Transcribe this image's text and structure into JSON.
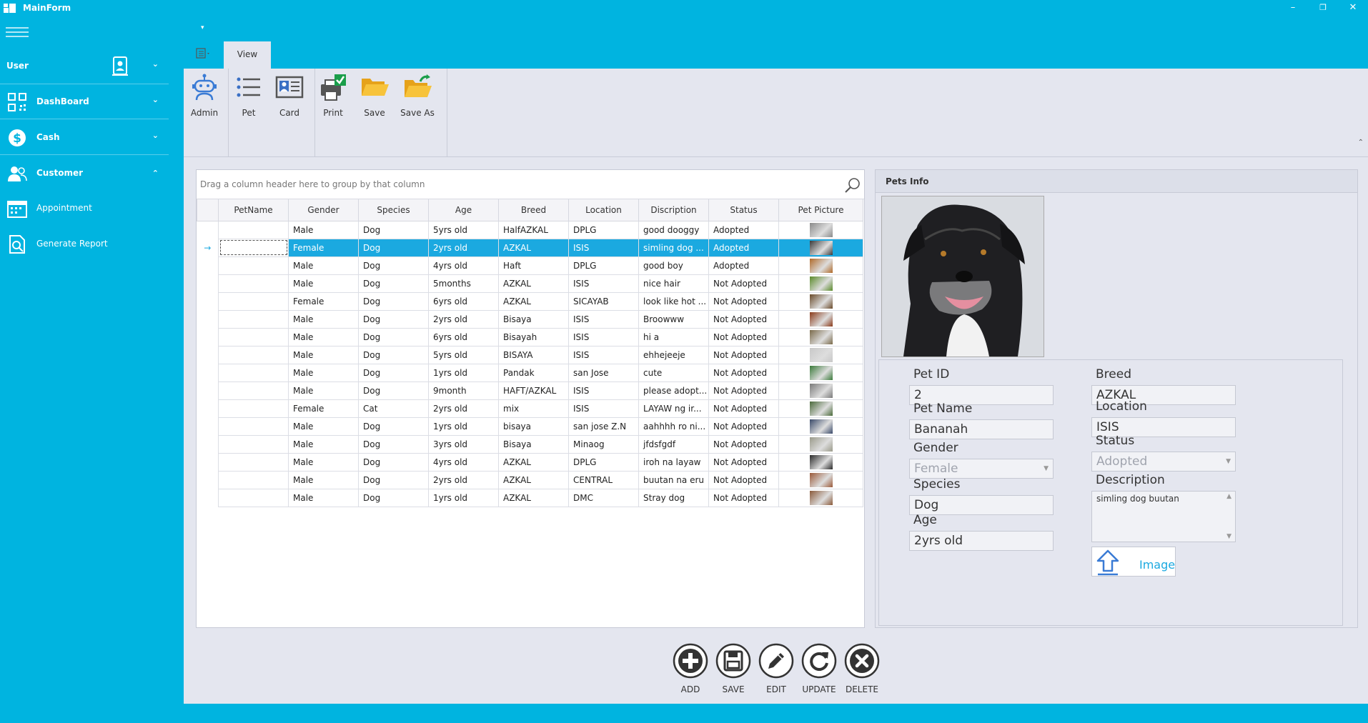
{
  "window": {
    "title": "MainForm",
    "controls": [
      "minimize",
      "restore",
      "close"
    ]
  },
  "sidebar": {
    "user_label": "User",
    "items": [
      {
        "label": "DashBoard",
        "icon": "qr-code-icon",
        "expanded": false
      },
      {
        "label": "Cash",
        "icon": "dollar-icon",
        "expanded": false
      },
      {
        "label": "Customer",
        "icon": "users-icon",
        "expanded": true
      }
    ],
    "sub_items": [
      {
        "label": "Appointment",
        "icon": "calendar-icon"
      },
      {
        "label": "Generate Report",
        "icon": "report-search-icon"
      }
    ]
  },
  "ribbon": {
    "tab": "View",
    "buttons": [
      {
        "label": "Admin",
        "icon": "robot-icon"
      },
      {
        "label": "Pet",
        "icon": "list-icon"
      },
      {
        "label": "Card",
        "icon": "id-card-icon"
      },
      {
        "label": "Print",
        "icon": "printer-icon"
      },
      {
        "label": "Save",
        "icon": "folder-icon"
      },
      {
        "label": "Save As",
        "icon": "folder-refresh-icon"
      }
    ]
  },
  "grid": {
    "group_panel_text": "Drag a column header here to group by that column",
    "columns": [
      "PetName",
      "Gender",
      "Species",
      "Age",
      "Breed",
      "Location",
      "Discription",
      "Status",
      "Pet Picture"
    ],
    "selected_row_index": 1,
    "rows": [
      [
        "",
        "Male",
        "Dog",
        "5yrs old",
        "HalfAZKAL",
        "DPLG",
        "good dooggy",
        "Adopted"
      ],
      [
        "",
        "Female",
        "Dog",
        "2yrs old",
        "AZKAL",
        "ISIS",
        "simling dog ...",
        "Adopted"
      ],
      [
        "",
        "Male",
        "Dog",
        "4yrs old",
        "Haft",
        "DPLG",
        "good boy",
        "Adopted"
      ],
      [
        "",
        "Male",
        "Dog",
        "5months",
        "AZKAL",
        "ISIS",
        "nice hair",
        "Not Adopted"
      ],
      [
        "",
        "Female",
        "Dog",
        "6yrs old",
        "AZKAL",
        "SICAYAB",
        "look like hot ...",
        "Not Adopted"
      ],
      [
        "",
        "Male",
        "Dog",
        "2yrs old",
        "Bisaya",
        "ISIS",
        "Broowww",
        "Not Adopted"
      ],
      [
        "",
        "Male",
        "Dog",
        "6yrs old",
        "Bisayah",
        "ISIS",
        "hi a",
        "Not Adopted"
      ],
      [
        "",
        "Male",
        "Dog",
        "5yrs old",
        "BISAYA",
        "ISIS",
        "ehhejeeje",
        "Not Adopted"
      ],
      [
        "",
        "Male",
        "Dog",
        "1yrs old",
        "Pandak",
        "san Jose",
        "cute",
        "Not Adopted"
      ],
      [
        "",
        "Male",
        "Dog",
        "9month",
        "HAFT/AZKAL",
        "ISIS",
        "please adopt...",
        "Not Adopted"
      ],
      [
        "",
        "Female",
        "Cat",
        "2yrs old",
        "mix",
        "ISIS",
        "LAYAW ng ir...",
        "Not Adopted"
      ],
      [
        "",
        "Male",
        "Dog",
        "1yrs old",
        "bisaya",
        "san jose  Z.N",
        "aahhhh ro ni...",
        "Not Adopted"
      ],
      [
        "",
        "Male",
        "Dog",
        "3yrs old",
        "Bisaya",
        "Minaog",
        "jfdsfgdf",
        "Not Adopted"
      ],
      [
        "",
        "Male",
        "Dog",
        "4yrs old",
        "AZKAL",
        "DPLG",
        "iroh na layaw",
        "Not Adopted"
      ],
      [
        "",
        "Male",
        "Dog",
        "2yrs old",
        "AZKAL",
        "CENTRAL",
        "buutan na eru",
        "Not Adopted"
      ],
      [
        "",
        "Male",
        "Dog",
        "1yrs old",
        "AZKAL",
        "DMC",
        "Stray dog",
        "Not Adopted"
      ]
    ],
    "thumb_colors": [
      "#8a8a8a",
      "#3a3a3a",
      "#b06a2a",
      "#5a8a2a",
      "#6a4a2a",
      "#8a3a1a",
      "#7a6a4a",
      "#c8c8c8",
      "#3a7a3a",
      "#7a7a7a",
      "#4a6a3a",
      "#3a4a6a",
      "#9a9a8a",
      "#2a2a2a",
      "#9a5a3a",
      "#8a5a3a"
    ]
  },
  "pets_info": {
    "title": "Pets Info",
    "labels": {
      "pet_id": "Pet ID",
      "pet_name": "Pet Name",
      "gender": "Gender",
      "species": "Species",
      "age": "Age",
      "breed": "Breed",
      "location": "Location",
      "status": "Status",
      "description": "Description"
    },
    "values": {
      "pet_id": "2",
      "pet_name": "Bananah",
      "gender": "Female",
      "species": "Dog",
      "age": "2yrs old",
      "breed": "AZKAL",
      "location": "ISIS",
      "status": "Adopted",
      "description": "simling dog buutan"
    },
    "image_button": "Image"
  },
  "actions": [
    {
      "label": "ADD",
      "icon": "plus-circle-icon"
    },
    {
      "label": "SAVE",
      "icon": "floppy-disk-icon"
    },
    {
      "label": "EDIT",
      "icon": "pencil-icon"
    },
    {
      "label": "UPDATE",
      "icon": "refresh-icon"
    },
    {
      "label": "DELETE",
      "icon": "x-circle-icon"
    }
  ],
  "colors": {
    "accent": "#00b4e0",
    "selection": "#1ba9e0",
    "surface": "#e4e6ef"
  }
}
